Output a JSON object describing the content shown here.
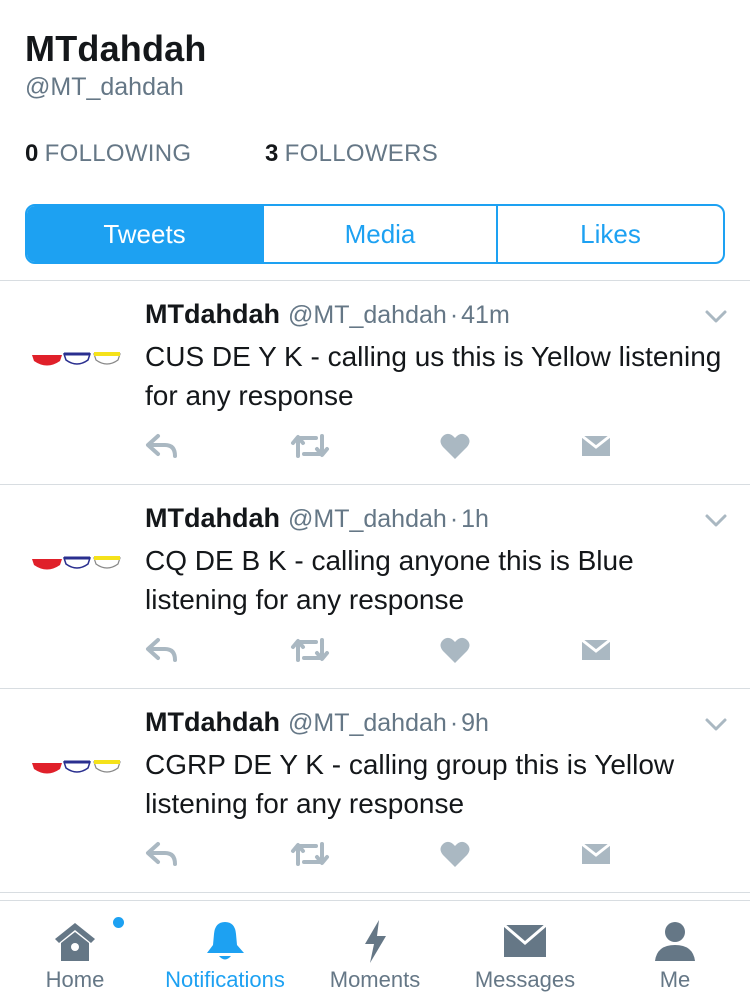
{
  "profile": {
    "display_name": "MTdahdah",
    "handle": "@MT_dahdah",
    "following_count": "0",
    "following_label": "FOLLOWING",
    "followers_count": "3",
    "followers_label": "FOLLOWERS"
  },
  "tabs": [
    {
      "label": "Tweets",
      "active": true
    },
    {
      "label": "Media",
      "active": false
    },
    {
      "label": "Likes",
      "active": false
    }
  ],
  "tweets": [
    {
      "name": "MTdahdah",
      "handle": "@MT_dahdah",
      "time": "41m",
      "text": "CUS DE Y K - calling us this is Yellow listening for any response"
    },
    {
      "name": "MTdahdah",
      "handle": "@MT_dahdah",
      "time": "1h",
      "text": "CQ DE B K - calling anyone this is Blue listening for any response"
    },
    {
      "name": "MTdahdah",
      "handle": "@MT_dahdah",
      "time": "9h",
      "text": "CGRP DE Y K - calling group this is Yellow listening for any response"
    }
  ],
  "separator": "·",
  "tabbar": {
    "home": "Home",
    "notifications": "Notifications",
    "moments": "Moments",
    "messages": "Messages",
    "me": "Me"
  },
  "colors": {
    "accent": "#1da1f2",
    "icon_gray": "#657786",
    "action_gray": "#aab8c2",
    "flag_red": "#e0202a",
    "flag_blue": "#2a2f8f",
    "flag_yellow": "#f5e21a"
  }
}
